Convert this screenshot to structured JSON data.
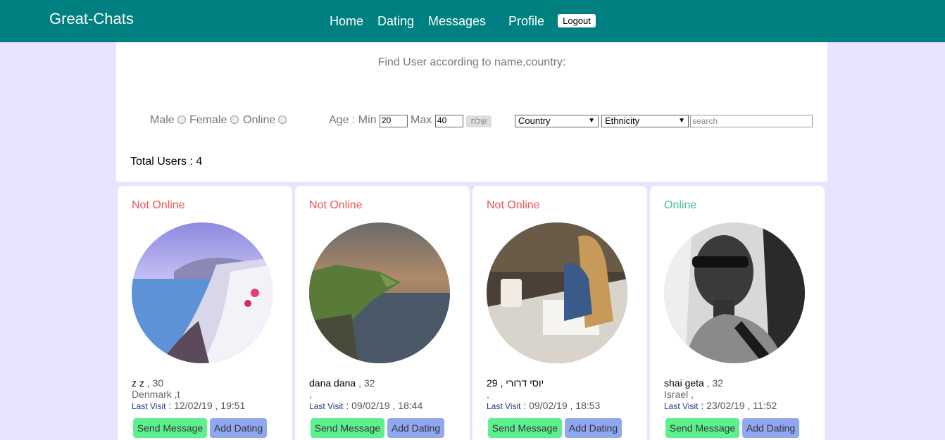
{
  "nav": {
    "brand": "Great-Chats",
    "home": "Home",
    "dating": "Dating",
    "messages": "Messages",
    "profile": "Profile",
    "logout": "Logout"
  },
  "search": {
    "title": "Find User according to name,country:",
    "male": "Male",
    "female": "Female",
    "online": "Online",
    "age_label": "Age : Min",
    "max_label": "Max",
    "min_value": "20",
    "max_value": "40",
    "send": "שלח",
    "country": "Country",
    "ethnicity": "Ethnicity",
    "search_placeholder": "search"
  },
  "total": "Total Users : 4",
  "cards": [
    {
      "status": "Not Online",
      "name": "z z",
      "age": " , 30",
      "location": "Denmark ,t",
      "visit_label": "Last Visit",
      "visit": " : 12/02/19 , 19:51",
      "send": "Send Message",
      "add": "Add Dating"
    },
    {
      "status": "Not Online",
      "name": "dana dana",
      "age": " , 32",
      "location": ",",
      "visit_label": "Last Visit",
      "visit": " : 09/02/19 , 18:44",
      "send": "Send Message",
      "add": "Add Dating"
    },
    {
      "status": "Not Online",
      "name": "29 , יוסי דרורי",
      "age": "",
      "location": ",",
      "visit_label": "Last Visit",
      "visit": " : 09/02/19 , 18:53",
      "send": "Send Message",
      "add": "Add Dating"
    },
    {
      "status": "Online",
      "name": "shai geta",
      "age": " , 32",
      "location": "Israel ,",
      "visit_label": "Last Visit",
      "visit": " : 23/02/19 , 11:52",
      "send": "Send Message",
      "add": "Add Dating"
    }
  ],
  "colors": {
    "nav": "#008080",
    "online": "#44c088",
    "offline": "#ee5555",
    "send_btn": "#5ef08e",
    "dating_btn": "#8fa8f0"
  }
}
